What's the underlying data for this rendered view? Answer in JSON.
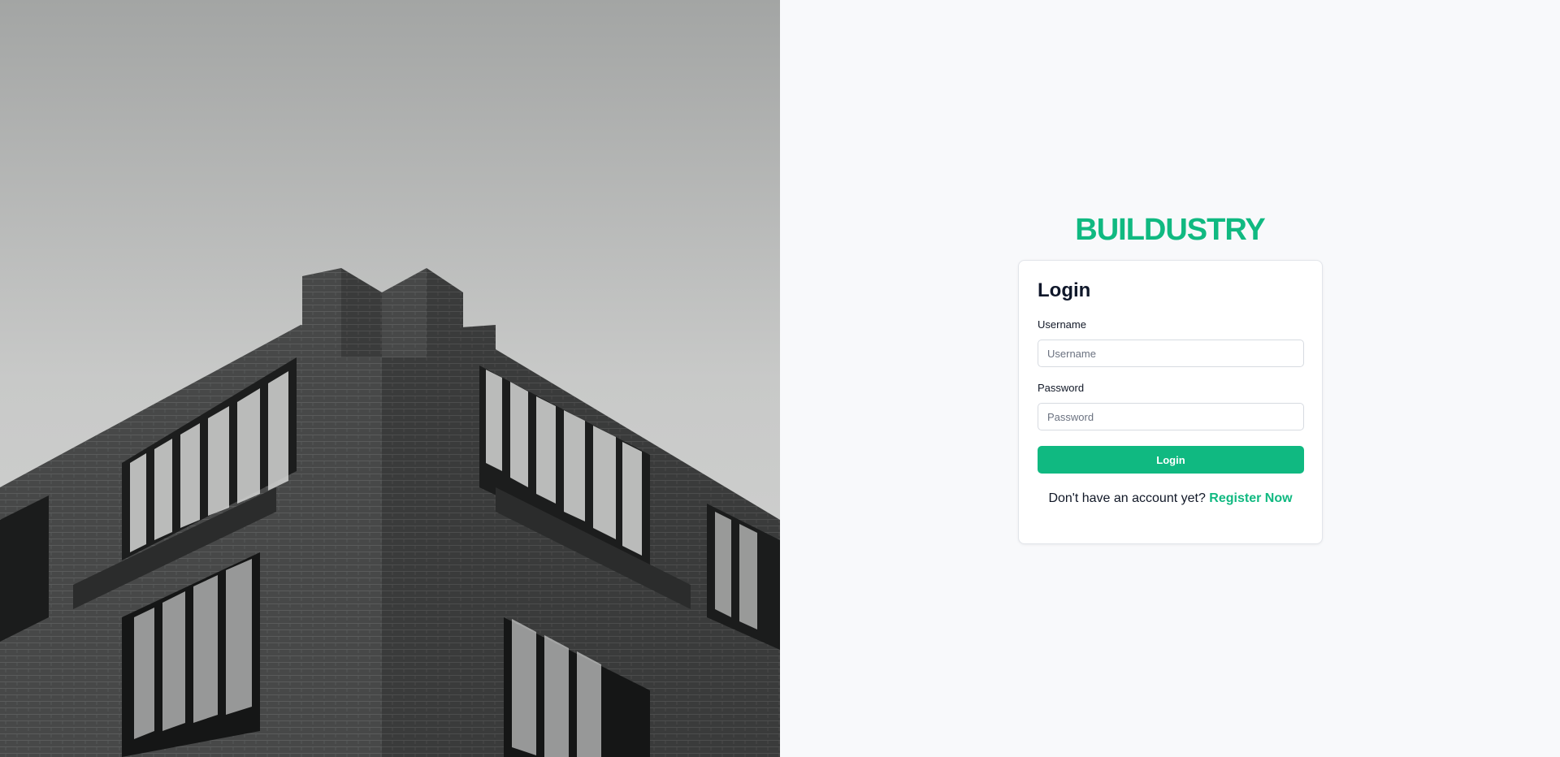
{
  "brand": {
    "name": "BUILDUSTRY",
    "color": "#10b981"
  },
  "hero_image": {
    "description_icon": "building-photo"
  },
  "login_card": {
    "title": "Login",
    "username": {
      "label": "Username",
      "placeholder": "Username",
      "value": ""
    },
    "password": {
      "label": "Password",
      "placeholder": "Password",
      "value": ""
    },
    "submit_label": "Login",
    "register_prompt": "Don't have an account yet?",
    "register_link": "Register Now"
  },
  "colors": {
    "accent": "#10b981",
    "page_background": "#f8f9fb",
    "card_border": "#e2e5ea"
  }
}
